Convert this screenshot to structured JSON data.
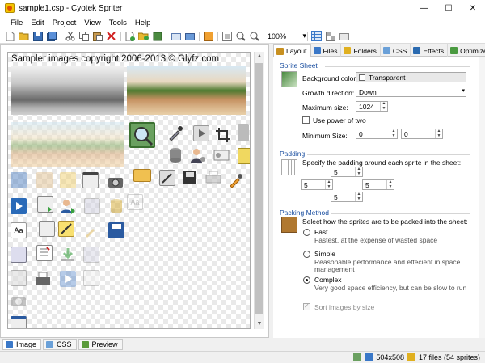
{
  "window": {
    "title": "sample1.csp - Cyotek Spriter",
    "minimize": "—",
    "maximize": "☐",
    "close": "✕"
  },
  "menu": [
    {
      "label": "File"
    },
    {
      "label": "Edit"
    },
    {
      "label": "Project"
    },
    {
      "label": "View"
    },
    {
      "label": "Tools"
    },
    {
      "label": "Help"
    }
  ],
  "toolbar": {
    "zoom": "100%"
  },
  "canvas": {
    "copyright": "Sampler images copyright 2006-2013 © Glyfz.com"
  },
  "bottom_tabs": [
    {
      "label": "Image",
      "color": "#3a78c8"
    },
    {
      "label": "CSS",
      "color": "#6aa0d8"
    },
    {
      "label": "Preview",
      "color": "#5a9a3a"
    }
  ],
  "status": {
    "dimensions": "504x508",
    "files": "17 files (54 sprites)"
  },
  "tabs": [
    {
      "label": "Layout",
      "color": "#c89020"
    },
    {
      "label": "Files",
      "color": "#3a78c8"
    },
    {
      "label": "Folders",
      "color": "#e0b020"
    },
    {
      "label": "CSS",
      "color": "#6aa0d8"
    },
    {
      "label": "Effects",
      "color": "#2a6ab0"
    },
    {
      "label": "Optimize",
      "color": "#4a9a40"
    }
  ],
  "sprite_sheet": {
    "title": "Sprite Sheet",
    "background_label": "Background color:",
    "background_value": "Transparent",
    "growth_label": "Growth direction:",
    "growth_value": "Down",
    "max_size_label": "Maximum size:",
    "max_size_value": "1024",
    "pow2_label": "Use power of two",
    "min_size_label": "Minimum Size:",
    "min_w": "0",
    "min_h": "0"
  },
  "padding": {
    "title": "Padding",
    "desc": "Specify the padding around each sprite in the sheet:",
    "top": "5",
    "left": "5",
    "right": "5",
    "bottom": "5"
  },
  "packing": {
    "title": "Packing Method",
    "desc": "Select how the sprites are to be packed into the sheet:",
    "fast_label": "Fast",
    "fast_desc": "Fastest, at the expense of wasted space",
    "simple_label": "Simple",
    "simple_desc1": "Reasonable performance and effecient in space",
    "simple_desc2": "management",
    "complex_label": "Complex",
    "complex_desc": "Very good space efficiency, but can be slow to run",
    "selected": "Complex",
    "sort_label": "Sort images by size"
  }
}
